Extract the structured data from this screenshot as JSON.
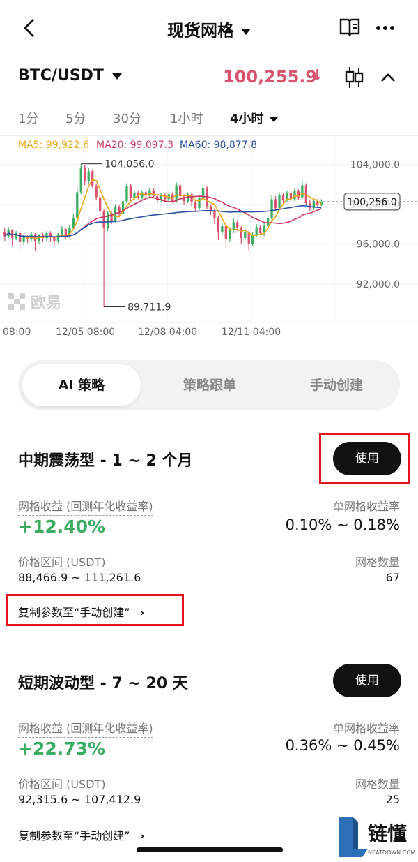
{
  "header": {
    "title": "现货网格"
  },
  "pair": {
    "symbol": "BTC/USDT",
    "price": "100,255.9",
    "price_arrow": "↓"
  },
  "timeframes": [
    {
      "label": "1分"
    },
    {
      "label": "5分"
    },
    {
      "label": "30分"
    },
    {
      "label": "1小时"
    },
    {
      "label": "4小时"
    }
  ],
  "chart": {
    "ma": [
      {
        "label": "MA5: 99,922.6",
        "color": "#e6a817"
      },
      {
        "label": "MA20: 99,097.3",
        "color": "#c8375f"
      },
      {
        "label": "MA60: 98,877.8",
        "color": "#2a4fa0"
      }
    ],
    "y_ticks": [
      "104,000.0",
      "100,000.0",
      "96,000.0",
      "92,000.0"
    ],
    "x_ticks": [
      "08:00",
      "12/05 08:00",
      "12/08 04:00",
      "12/11 04:00"
    ],
    "high_label": "104,056.0",
    "low_label": "89,711.9",
    "last_label": "100,256.0",
    "watermark": "欧易",
    "up_color": "#3aad63",
    "down_color": "#d9536f"
  },
  "chart_data": {
    "type": "candlestick",
    "ylim": [
      88000,
      105500
    ],
    "candles": [
      [
        97200,
        96800,
        97600,
        96300
      ],
      [
        96800,
        97400,
        97700,
        96600
      ],
      [
        97400,
        96600,
        97500,
        95800
      ],
      [
        96600,
        97100,
        97300,
        96400
      ],
      [
        97100,
        96200,
        97300,
        95500
      ],
      [
        96200,
        96700,
        96900,
        95900
      ],
      [
        96700,
        96500,
        96900,
        96100
      ],
      [
        96500,
        97000,
        97200,
        96300
      ],
      [
        97000,
        96300,
        97100,
        95300
      ],
      [
        96300,
        96900,
        97000,
        96000
      ],
      [
        96900,
        96600,
        97100,
        96200
      ],
      [
        96600,
        97100,
        97300,
        96300
      ],
      [
        97100,
        96700,
        97300,
        96200
      ],
      [
        96700,
        96300,
        96800,
        95800
      ],
      [
        96300,
        96900,
        97100,
        96100
      ],
      [
        96900,
        97500,
        97800,
        96700
      ],
      [
        97500,
        96800,
        97600,
        96500
      ],
      [
        96800,
        97600,
        97900,
        96600
      ],
      [
        97600,
        98600,
        99000,
        97400
      ],
      [
        98600,
        101200,
        101700,
        98400
      ],
      [
        101200,
        103700,
        104056,
        101000
      ],
      [
        103700,
        102300,
        103900,
        101900
      ],
      [
        102300,
        103300,
        103600,
        102000
      ],
      [
        103300,
        101800,
        103500,
        101600
      ],
      [
        101800,
        100700,
        102000,
        100400
      ],
      [
        100700,
        99300,
        100800,
        98900
      ],
      [
        99300,
        97600,
        99500,
        89712
      ],
      [
        97600,
        99100,
        99300,
        97300
      ],
      [
        99100,
        98300,
        99300,
        98000
      ],
      [
        98300,
        99700,
        100000,
        98100
      ],
      [
        99700,
        99000,
        99900,
        98700
      ],
      [
        99000,
        100300,
        100600,
        98800
      ],
      [
        100300,
        101800,
        102100,
        100100
      ],
      [
        101800,
        100600,
        102000,
        100300
      ],
      [
        100600,
        101100,
        101300,
        100400
      ],
      [
        101100,
        100700,
        101300,
        100500
      ],
      [
        100700,
        101200,
        101400,
        100500
      ],
      [
        101200,
        100900,
        101400,
        100600
      ],
      [
        100900,
        101400,
        101600,
        100700
      ],
      [
        101400,
        100800,
        101600,
        100600
      ],
      [
        100800,
        100400,
        101000,
        100100
      ],
      [
        100400,
        100900,
        101100,
        100200
      ],
      [
        100900,
        100500,
        101100,
        100300
      ],
      [
        100500,
        101000,
        101200,
        100300
      ],
      [
        101000,
        100300,
        101200,
        100100
      ],
      [
        100300,
        101900,
        102200,
        100100
      ],
      [
        101900,
        100800,
        102100,
        100600
      ],
      [
        100800,
        100300,
        101000,
        99900
      ],
      [
        100300,
        101000,
        101200,
        100100
      ],
      [
        101000,
        100200,
        101200,
        99800
      ],
      [
        100200,
        99600,
        100400,
        99300
      ],
      [
        99600,
        100600,
        100900,
        99400
      ],
      [
        100600,
        101600,
        102000,
        100400
      ],
      [
        101600,
        99800,
        101800,
        99500
      ],
      [
        99800,
        99300,
        100000,
        98900
      ],
      [
        99300,
        98600,
        99600,
        98000
      ],
      [
        98600,
        97200,
        98800,
        96400
      ],
      [
        97200,
        97800,
        98100,
        96900
      ],
      [
        97800,
        96500,
        98000,
        95600
      ],
      [
        96500,
        97400,
        97700,
        96200
      ],
      [
        97400,
        98200,
        98600,
        97100
      ],
      [
        98200,
        97600,
        98400,
        97300
      ],
      [
        97600,
        96600,
        97800,
        96000
      ],
      [
        96600,
        97200,
        97500,
        96300
      ],
      [
        97200,
        96000,
        97400,
        95300
      ],
      [
        96000,
        96900,
        97200,
        95800
      ],
      [
        96900,
        97700,
        98000,
        96700
      ],
      [
        97700,
        97100,
        97900,
        96900
      ],
      [
        97100,
        97800,
        98100,
        96800
      ],
      [
        97800,
        98600,
        98900,
        97600
      ],
      [
        98600,
        100500,
        100900,
        98400
      ],
      [
        100500,
        99600,
        100800,
        99300
      ],
      [
        99600,
        100900,
        101200,
        99400
      ],
      [
        100900,
        100400,
        101100,
        100100
      ],
      [
        100400,
        101100,
        101300,
        100200
      ],
      [
        101100,
        100500,
        101300,
        100300
      ],
      [
        100500,
        101300,
        101600,
        100300
      ],
      [
        101300,
        100700,
        101500,
        100400
      ],
      [
        100700,
        101900,
        102300,
        100500
      ],
      [
        101900,
        100100,
        102100,
        99900
      ],
      [
        100100,
        99600,
        100400,
        99300
      ],
      [
        99600,
        100300,
        100500,
        99400
      ],
      [
        100300,
        99900,
        100500,
        99700
      ],
      [
        99900,
        100256,
        100500,
        99800
      ]
    ]
  },
  "segment": {
    "tabs": [
      {
        "label": "AI 策略"
      },
      {
        "label": "策略跟单"
      },
      {
        "label": "手动创建"
      }
    ]
  },
  "strategies": [
    {
      "title": "中期震荡型 - 1 ~ 2 个月",
      "use_label": "使用",
      "yield_label": "网格收益 (回测年化收益率)",
      "yield_value": "+12.40%",
      "per_grid_label": "单网格收益率",
      "per_grid_value": "0.10% ~ 0.18%",
      "range_label": "价格区间 (USDT)",
      "range_value": "88,466.9 ~ 111,261.6",
      "count_label": "网格数量",
      "count_value": "67",
      "copy_label": "复制参数至“手动创建”"
    },
    {
      "title": "短期波动型 - 7 ~ 20 天",
      "use_label": "使用",
      "yield_label": "网格收益 (回测年化收益率)",
      "yield_value": "+22.73%",
      "per_grid_label": "单网格收益率",
      "per_grid_value": "0.36% ~ 0.45%",
      "range_label": "价格区间 (USDT)",
      "range_value": "92,315.6 ~ 107,412.9",
      "count_label": "网格数量",
      "count_value": "25",
      "copy_label": "复制参数至“手动创建”"
    }
  ],
  "watermark": {
    "text": "链懂",
    "sub": "NEATDOWN.COM"
  }
}
